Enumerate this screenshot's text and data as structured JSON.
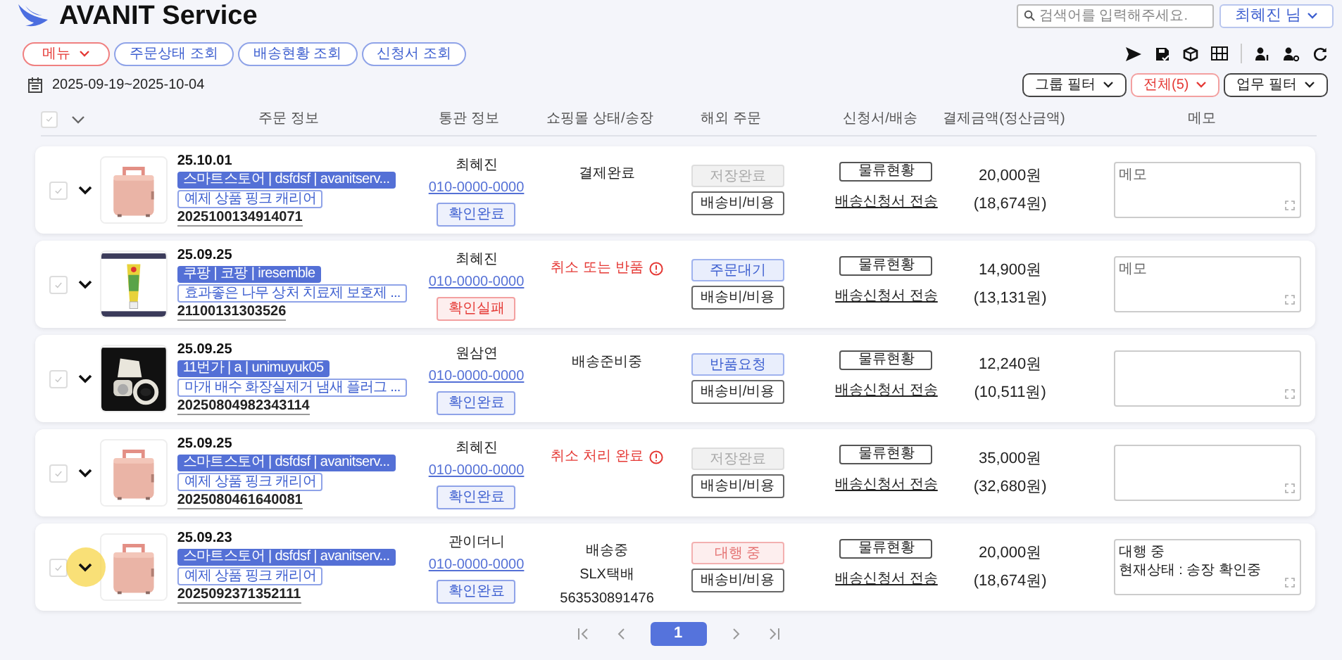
{
  "header": {
    "title": "AVANIT Service",
    "search": {
      "placeholder": "검색어를 입력해주세요."
    },
    "user_button": "최혜진 님"
  },
  "nav_tabs": [
    {
      "label": "메뉴",
      "kind": "menu"
    },
    {
      "label": "주문상태 조회",
      "kind": "link"
    },
    {
      "label": "배송현황 조회",
      "kind": "link"
    },
    {
      "label": "신청서 조회",
      "kind": "link"
    }
  ],
  "date_range": "2025-09-19~2025-10-04",
  "filters": [
    {
      "label": "그룹 필터",
      "kind": "normal"
    },
    {
      "label": "전체(5)",
      "kind": "alert"
    },
    {
      "label": "업무 필터",
      "kind": "normal"
    }
  ],
  "header_checkbox": {
    "checked": false
  },
  "columns": [
    "주문 정보",
    "통관 정보",
    "쇼핑몰 상태/송장",
    "해외 주문",
    "신청서/배송",
    "결제금액(정산금액)",
    "메모"
  ],
  "orders": [
    {
      "checked": false,
      "highlighted": false,
      "date": "25.10.01",
      "store": "스마트스토어 | dsfdsf | avanitserv...",
      "product": "예제 상품 핑크 캐리어",
      "order_no": "2025100134914071",
      "customer": "최혜진",
      "phone": "010-0000-0000",
      "customs": {
        "label": "확인완료",
        "kind": "ok"
      },
      "shop_status": {
        "lines": [
          "결제완료"
        ],
        "alert": false
      },
      "overseas": {
        "label": "저장완료",
        "kind": "saved"
      },
      "fee_button": "배송비/비용",
      "logistics_button": "물류현황",
      "send_link": "배송신청서 전송",
      "amount": "20,000원",
      "settlement": "(18,674원)",
      "memo": {
        "placeholder": "메모"
      }
    },
    {
      "checked": false,
      "highlighted": false,
      "date": "25.09.25",
      "store": "쿠팡 | 코팡 | iresemble",
      "product": "효과좋은 나무 상처 치료제 보호제 ...",
      "order_no": "21100131303526",
      "customer": "최혜진",
      "phone": "010-0000-0000",
      "customs": {
        "label": "확인실패",
        "kind": "fail"
      },
      "shop_status": {
        "lines": [
          "취소 또는 반품"
        ],
        "alert": true
      },
      "overseas": {
        "label": "주문대기",
        "kind": "active"
      },
      "fee_button": "배송비/비용",
      "logistics_button": "물류현황",
      "send_link": "배송신청서 전송",
      "amount": "14,900원",
      "settlement": "(13,131원)",
      "memo": {
        "placeholder": "메모"
      }
    },
    {
      "checked": false,
      "highlighted": false,
      "date": "25.09.25",
      "store": "11번가 | a | unimuyuk05",
      "product": "마개 배수 화장실제거 냄새 플러그 ...",
      "order_no": "20250804982343114",
      "customer": "원삼연",
      "phone": "010-0000-0000",
      "customs": {
        "label": "확인완료",
        "kind": "ok"
      },
      "shop_status": {
        "lines": [
          "배송준비중"
        ],
        "alert": false
      },
      "overseas": {
        "label": "반품요청",
        "kind": "active"
      },
      "fee_button": "배송비/비용",
      "logistics_button": "물류현황",
      "send_link": "배송신청서 전송",
      "amount": "12,240원",
      "settlement": "(10,511원)"
    },
    {
      "checked": false,
      "highlighted": false,
      "date": "25.09.25",
      "store": "스마트스토어 | dsfdsf | avanitserv...",
      "product": "예제 상품 핑크 캐리어",
      "order_no": "2025080461640081",
      "customer": "최혜진",
      "phone": "010-0000-0000",
      "customs": {
        "label": "확인완료",
        "kind": "ok"
      },
      "shop_status": {
        "lines": [
          "취소 처리 완료"
        ],
        "alert": true
      },
      "overseas": {
        "label": "저장완료",
        "kind": "saved"
      },
      "fee_button": "배송비/비용",
      "logistics_button": "물류현황",
      "send_link": "배송신청서 전송",
      "amount": "35,000원",
      "settlement": "(32,680원)"
    },
    {
      "checked": false,
      "highlighted": true,
      "date": "25.09.23",
      "store": "스마트스토어 | dsfdsf | avanitserv...",
      "product": "예제 상품 핑크 캐리어",
      "order_no": "2025092371352111",
      "customer": "관이더니",
      "phone": "010-0000-0000",
      "customs": {
        "label": "확인완료",
        "kind": "ok"
      },
      "shop_status": {
        "lines": [
          "배송중",
          "SLX택배",
          "563530891476"
        ],
        "alert": false
      },
      "overseas": {
        "label": "대행 중",
        "kind": "warning"
      },
      "fee_button": "배송비/비용",
      "logistics_button": "물류현황",
      "send_link": "배송신청서 전송",
      "amount": "20,000원",
      "settlement": "(18,674원)",
      "memo": {
        "value": "대행 중\n현재상태 : 송장 확인중"
      }
    }
  ],
  "pagination": {
    "pages": [
      {
        "label": "1",
        "selected": true
      }
    ]
  }
}
